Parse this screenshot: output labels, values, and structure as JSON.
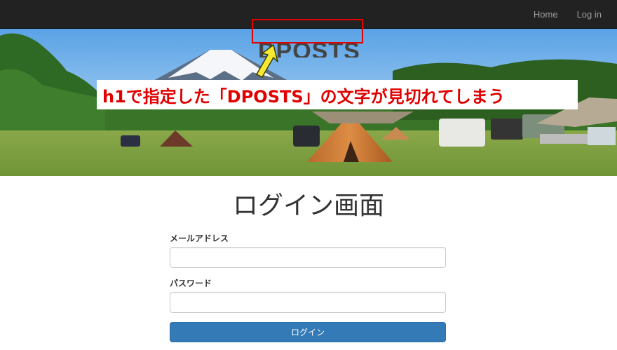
{
  "navbar": {
    "links": [
      {
        "label": "Home"
      },
      {
        "label": "Log in"
      }
    ]
  },
  "hero": {
    "site_title": "DPOSTS",
    "annotation_text": "h1で指定した「DPOSTS」の文字が見切れてしまう"
  },
  "login": {
    "heading": "ログイン画面",
    "email_label": "メールアドレス",
    "email_value": "",
    "password_label": "パスワード",
    "password_value": "",
    "submit_label": "ログイン"
  },
  "colors": {
    "navbar_bg": "#222222",
    "annotation_red": "#e00000",
    "button_blue": "#337ab7"
  }
}
